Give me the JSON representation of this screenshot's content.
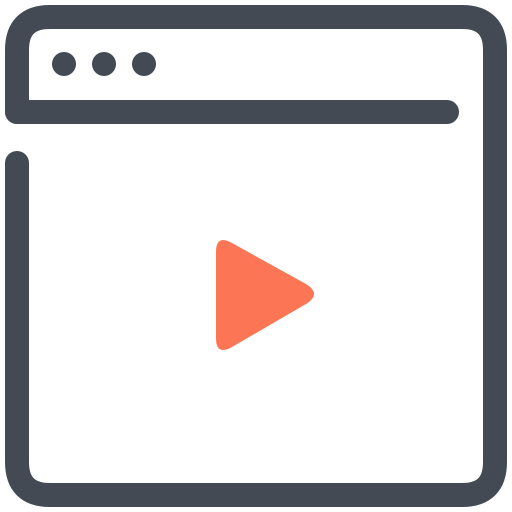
{
  "icon": {
    "name": "browser-video-icon",
    "frame_color": "#434a54",
    "play_color": "#fc7655",
    "background_color": "#ffffff"
  },
  "window": {
    "titlebar_dots": [
      {
        "name": "window-dot-1"
      },
      {
        "name": "window-dot-2"
      },
      {
        "name": "window-dot-3"
      }
    ]
  },
  "content": {
    "play_button": {
      "icon": "play-triangle-icon"
    }
  }
}
